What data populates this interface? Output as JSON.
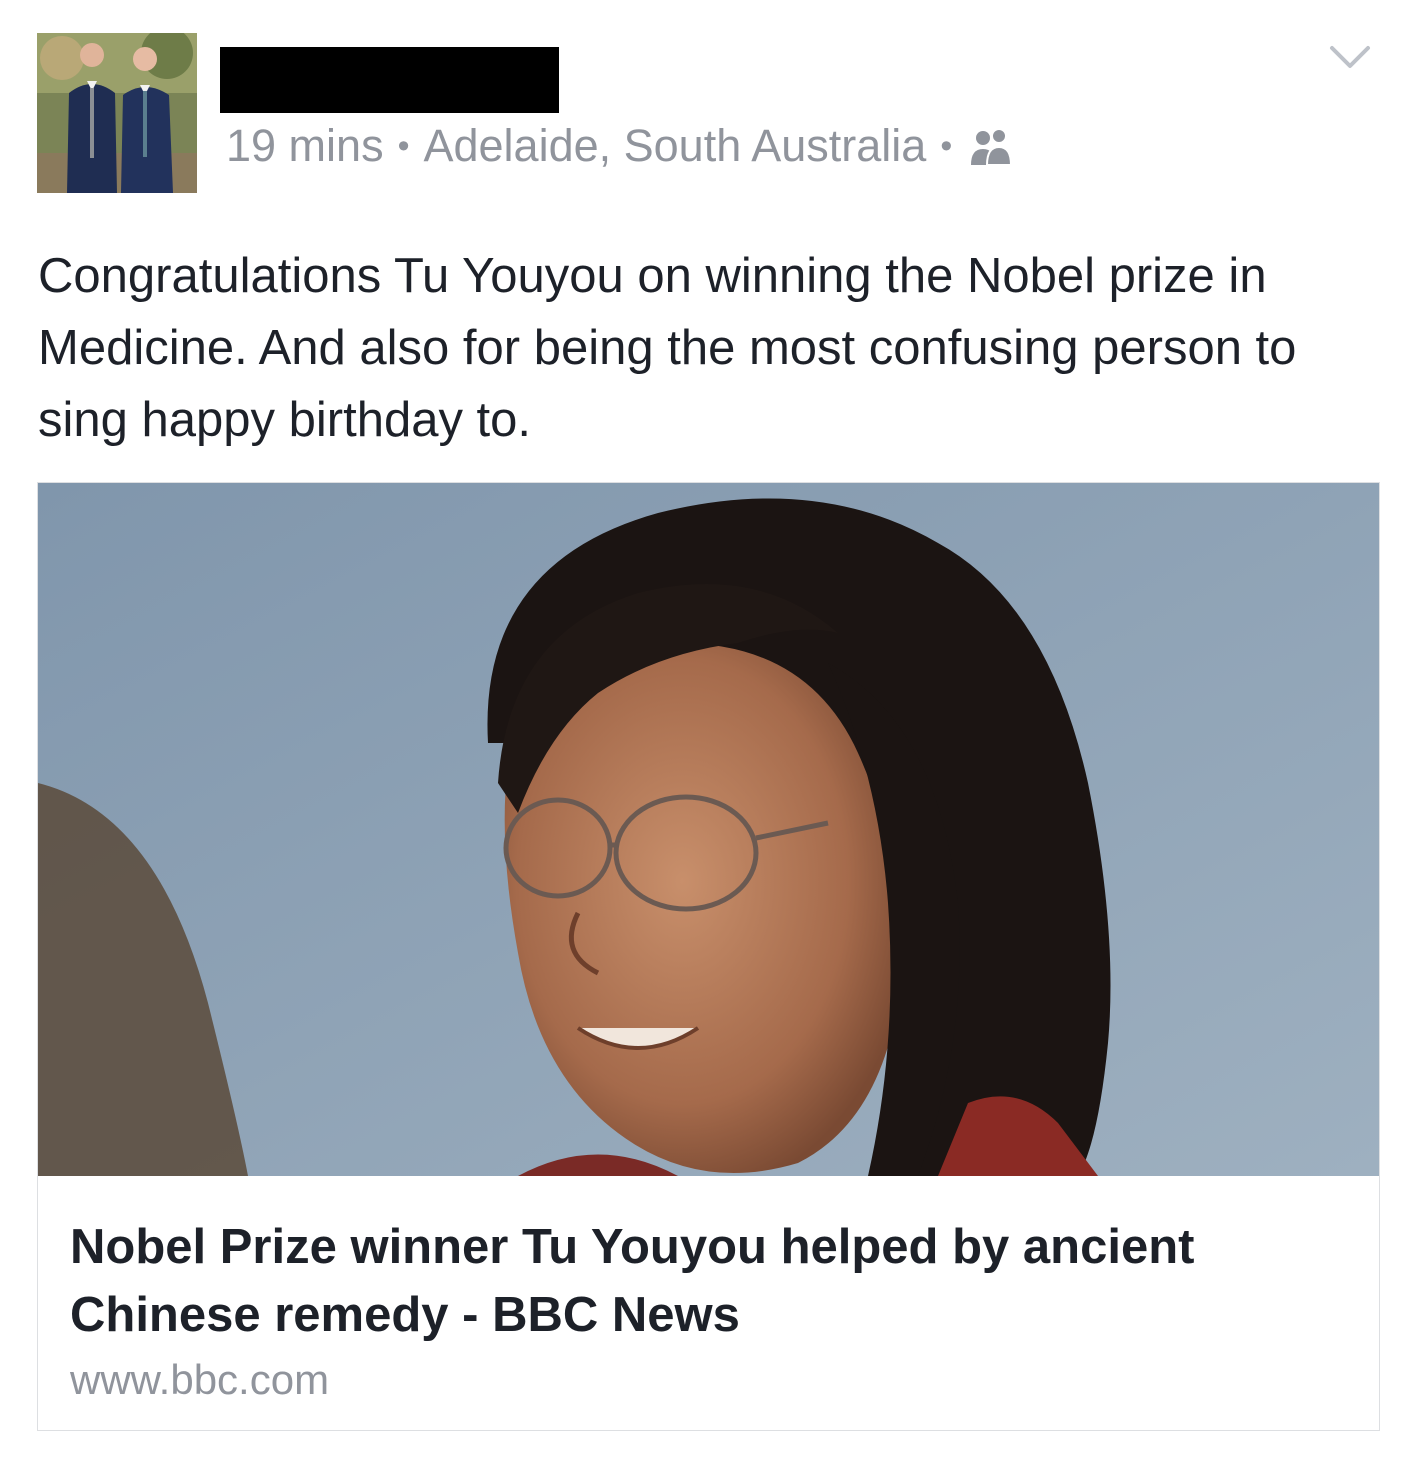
{
  "post": {
    "timestamp": "19 mins",
    "separator": "•",
    "location": "Adelaide, South Australia",
    "audience_icon": "friends-icon",
    "options_icon": "chevron-down-icon",
    "text": "Congratulations Tu Youyou on winning the Nobel prize in Medicine. And also for being the most confusing person to sing happy birthday to."
  },
  "link": {
    "title": "Nobel Prize winner Tu Youyou helped by ancient Chinese remedy - BBC News",
    "domain": "www.bbc.com"
  },
  "colors": {
    "text_primary": "#1d2129",
    "text_secondary": "#90949c",
    "card_border": "#dddfe2"
  }
}
